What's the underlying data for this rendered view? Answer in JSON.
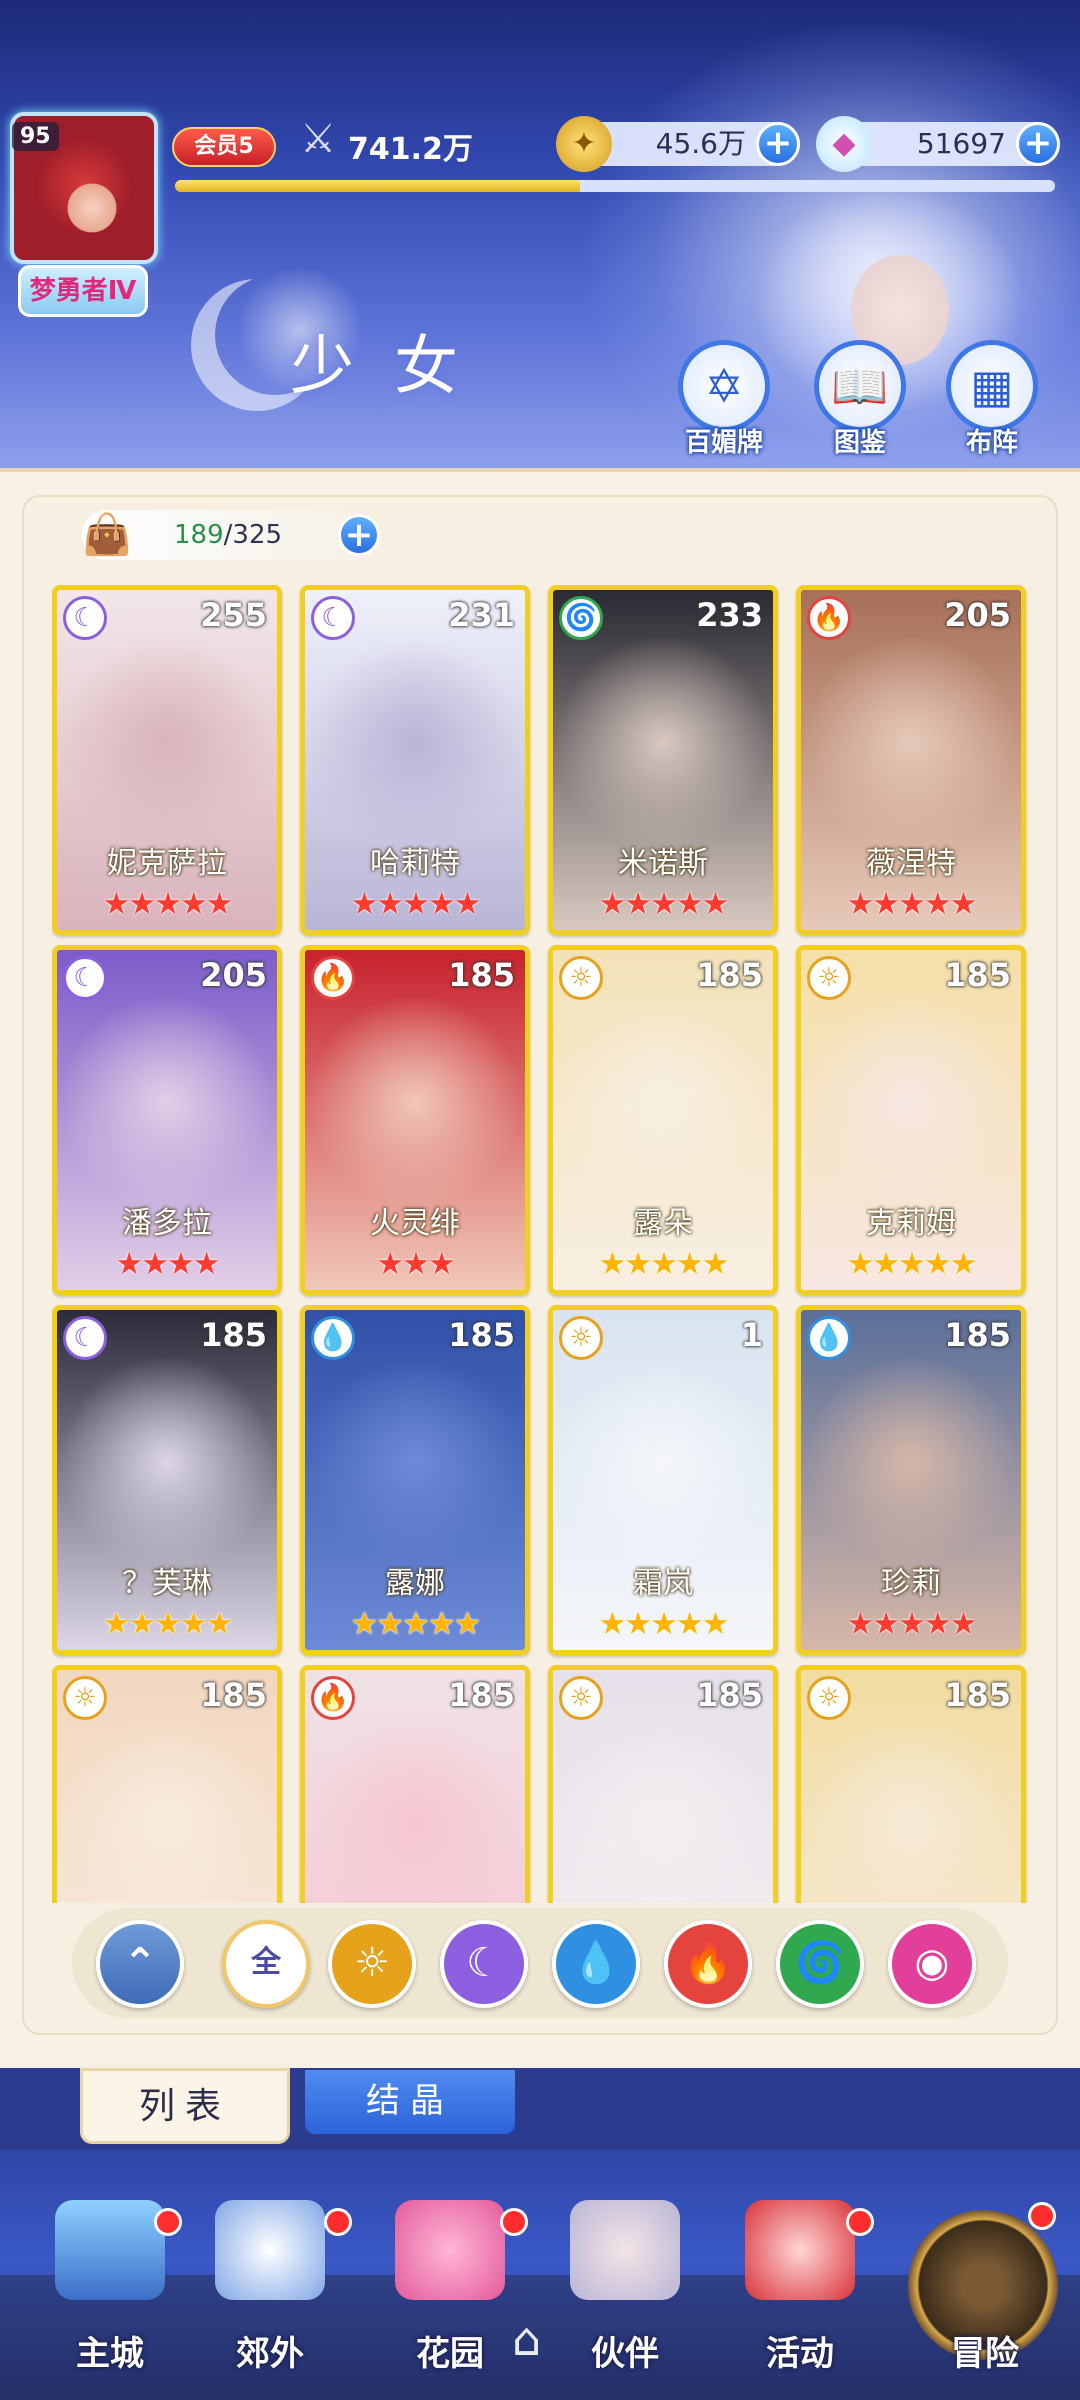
{
  "player": {
    "level": "95",
    "rank": "梦勇者Ⅳ",
    "vip": "会员5",
    "power": "741.2万",
    "exp_progress": 0.46
  },
  "resources": {
    "gold": "45.6万",
    "gems": "51697"
  },
  "header": {
    "title": "少女",
    "buttons": [
      "百媚牌",
      "图鉴",
      "布阵"
    ]
  },
  "capacity": {
    "current": "189",
    "separator": "/",
    "max": "325"
  },
  "element_colors": {
    "moon": "#8b5fe0",
    "fire": "#e5433d",
    "wind": "#2fa84f",
    "sun": "#e5a21a",
    "water": "#2f8fe0"
  },
  "cards": [
    {
      "name": "妮克萨拉",
      "level": "255",
      "element": "moon",
      "stars": "★★★★★",
      "star_color": "red",
      "art": [
        "#f2e6e8",
        "#d9b3bb"
      ]
    },
    {
      "name": "哈莉特",
      "level": "231",
      "element": "moon",
      "stars": "★★★★★",
      "star_color": "red",
      "art": [
        "#eef0fa",
        "#b9b5d6"
      ]
    },
    {
      "name": "米诺斯",
      "level": "233",
      "element": "wind",
      "stars": "★★★★★",
      "star_color": "red",
      "art": [
        "#2a2a33",
        "#d8c8c0"
      ]
    },
    {
      "name": "薇涅特",
      "level": "205",
      "element": "fire",
      "stars": "★★★★★",
      "star_color": "red",
      "art": [
        "#a87058",
        "#e6c9b9"
      ]
    },
    {
      "name": "潘多拉",
      "level": "205",
      "element": "moon",
      "stars": "★★★★",
      "star_color": "red",
      "art": [
        "#7b5cc9",
        "#e2cfe6"
      ]
    },
    {
      "name": "火灵绯",
      "level": "185",
      "element": "fire",
      "stars": "★★★",
      "star_color": "red",
      "art": [
        "#c8222e",
        "#f0c8b8"
      ]
    },
    {
      "name": "露朵",
      "level": "185",
      "element": "sun",
      "stars": "★★★★★",
      "star_color": "gold",
      "art": [
        "#f3e2b8",
        "#f8efe2"
      ]
    },
    {
      "name": "克莉姆",
      "level": "185",
      "element": "sun",
      "stars": "★★★★★",
      "star_color": "gold",
      "art": [
        "#f5e0a8",
        "#f6e7e2"
      ]
    },
    {
      "name": "？芙琳",
      "level": "185",
      "element": "moon",
      "stars": "★★★★★",
      "star_color": "gold",
      "art": [
        "#2b2b3a",
        "#dcd6e6"
      ]
    },
    {
      "name": "露娜",
      "level": "185",
      "element": "water",
      "stars": "★★★★★",
      "star_color": "gold",
      "art": [
        "#3150a8",
        "#6c8ad6"
      ]
    },
    {
      "name": "霜岚",
      "level": "1",
      "element": "sun",
      "stars": "★★★★★",
      "star_color": "gold",
      "art": [
        "#d8e4f0",
        "#f4f6fa"
      ]
    },
    {
      "name": "珍莉",
      "level": "185",
      "element": "water",
      "stars": "★★★★★",
      "star_color": "red",
      "art": [
        "#5a6f9a",
        "#d6b7a8"
      ]
    },
    {
      "name": "",
      "level": "185",
      "element": "sun",
      "stars": "",
      "star_color": "gold",
      "art": [
        "#f2d7c0",
        "#f8ecde"
      ]
    },
    {
      "name": "",
      "level": "185",
      "element": "fire",
      "stars": "",
      "star_color": "gold",
      "art": [
        "#f0e2e6",
        "#f6c6d0"
      ]
    },
    {
      "name": "",
      "level": "185",
      "element": "sun",
      "stars": "",
      "star_color": "gold",
      "art": [
        "#e6e0ea",
        "#f5eff2"
      ]
    },
    {
      "name": "",
      "level": "185",
      "element": "sun",
      "stars": "",
      "star_color": "gold",
      "art": [
        "#f1dca0",
        "#f6ead8"
      ]
    }
  ],
  "filters": {
    "all_label": "全"
  },
  "tabs": {
    "list": "列表",
    "crystal": "结晶"
  },
  "nav": {
    "main_city": "主城",
    "suburbs": "郊外",
    "garden": "花园",
    "partner": "伙伴",
    "events": "活动",
    "adventure": "冒险"
  }
}
